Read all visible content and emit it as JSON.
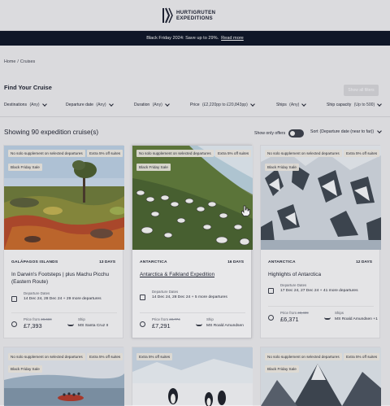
{
  "brand": {
    "line1": "HURTIGRUTEN",
    "line2": "EXPEDITIONS"
  },
  "promo": {
    "text": "Black Friday 2024: Save up to 29%.",
    "link": "Read more"
  },
  "breadcrumb": {
    "home": "Home",
    "sep": "/",
    "current": "Cruises"
  },
  "find_title": "Find Your Cruise",
  "filter_button": "Show all filters",
  "filters": [
    {
      "label": "Destinations",
      "value": "(Any)"
    },
    {
      "label": "Departure date",
      "value": "(Any)"
    },
    {
      "label": "Duration",
      "value": "(Any)"
    },
    {
      "label": "Price",
      "value": "(£2,220pp to £20,843pp)"
    },
    {
      "label": "Ships",
      "value": "(Any)"
    },
    {
      "label": "Ship capacity",
      "value": "(Up to 500)"
    }
  ],
  "showing": "Showing 90 expedition cruise(s)",
  "offers_label": "Show only offers",
  "sort": {
    "label": "Sort",
    "value": "(Departure date (near to far))"
  },
  "cards": [
    {
      "badge_supplement": "No solo supplement on selected departures",
      "badge_suite": "Extra 5% off suites",
      "badge_sale": "Black Friday Sale",
      "region": "GALÁPAGOS ISLANDS",
      "days": "13 DAYS",
      "title": "In Darwin's Footsteps | plus Machu Picchu (Eastern Route)",
      "dep_label": "Departure Dates",
      "dep_value": "14 Dec 24, 28 Dec 24 + 29 more departures",
      "price_label": "Price from",
      "price_old": "£9,669",
      "price": "£7,393",
      "ship_label": "Ship",
      "ship": "MS Santa Cruz II"
    },
    {
      "badge_supplement": "No solo supplement on selected departures",
      "badge_suite": "Extra 5% off suites",
      "badge_sale": "Black Friday Sale",
      "region": "ANTARCTICA",
      "days": "16 DAYS",
      "title": "Antarctica & Falkland Expedition",
      "dep_label": "Departure Dates",
      "dep_value": "14 Dec 24, 28 Dec 24 + 5 more departures",
      "price_label": "Price from",
      "price_old": "£9,774",
      "price": "£7,291",
      "ship_label": "Ship",
      "ship": "MS Roald Amundsen"
    },
    {
      "badge_supplement": "No solo supplement on selected departures",
      "badge_suite": "Extra 5% off suites",
      "badge_sale": "Black Friday Sale",
      "region": "ANTARCTICA",
      "days": "12 DAYS",
      "title": "Highlights of Antarctica",
      "dep_label": "Departure Dates",
      "dep_value": "17 Dec 24, 27 Dec 24 + 41 more departures",
      "price_label": "Price from",
      "price_old": "£8,499",
      "price": "£6,371",
      "ship_label": "Ships",
      "ship": "MS Roald Amundsen +1"
    },
    {
      "badge_supplement": "No solo supplement on selected departures",
      "badge_suite": "Extra 5% off suites",
      "badge_sale": "Black Friday Sale"
    },
    {
      "badge_suite": "Extra 5% off suites"
    },
    {
      "badge_supplement": "No solo supplement on selected departures",
      "badge_suite": "Extra 5% off suites",
      "badge_sale": "Black Friday Sale"
    }
  ]
}
